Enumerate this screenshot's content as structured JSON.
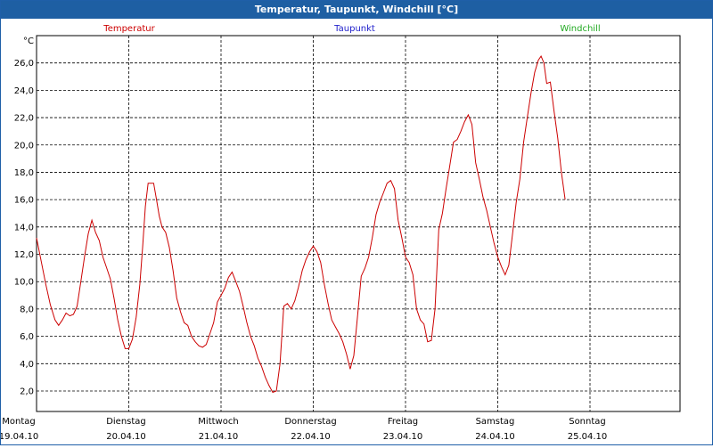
{
  "window": {
    "title": "Temperatur, Taupunkt, Windchill [°C]"
  },
  "chart_data": {
    "type": "line",
    "title": "Temperatur, Taupunkt, Windchill [°C]",
    "ylabel": "°C",
    "ylim": [
      0.5,
      28.0
    ],
    "yticks": [
      "2,0",
      "4,0",
      "6,0",
      "8,0",
      "10,0",
      "12,0",
      "14,0",
      "16,0",
      "18,0",
      "20,0",
      "22,0",
      "24,0",
      "26,0"
    ],
    "ytick_values": [
      2,
      4,
      6,
      8,
      10,
      12,
      14,
      16,
      18,
      20,
      22,
      24,
      26
    ],
    "xlim": [
      0,
      7
    ],
    "xticks": [
      {
        "day": "Montag",
        "date": "19.04.10"
      },
      {
        "day": "Dienstag",
        "date": "20.04.10"
      },
      {
        "day": "Mittwoch",
        "date": "21.04.10"
      },
      {
        "day": "Donnerstag",
        "date": "22.04.10"
      },
      {
        "day": "Freitag",
        "date": "23.04.10"
      },
      {
        "day": "Samstag",
        "date": "24.04.10"
      },
      {
        "day": "Sonntag",
        "date": "25.04.10"
      }
    ],
    "grid": true,
    "legend_position": "top",
    "series": [
      {
        "name": "Temperatur",
        "color": "#cc0000",
        "points": [
          [
            0.0,
            13.2
          ],
          [
            0.05,
            11.5
          ],
          [
            0.1,
            9.8
          ],
          [
            0.15,
            8.3
          ],
          [
            0.2,
            7.2
          ],
          [
            0.24,
            6.8
          ],
          [
            0.28,
            7.2
          ],
          [
            0.32,
            7.7
          ],
          [
            0.36,
            7.5
          ],
          [
            0.4,
            7.6
          ],
          [
            0.44,
            8.2
          ],
          [
            0.48,
            10.0
          ],
          [
            0.52,
            11.8
          ],
          [
            0.56,
            13.5
          ],
          [
            0.6,
            14.5
          ],
          [
            0.64,
            13.6
          ],
          [
            0.68,
            13.0
          ],
          [
            0.72,
            11.8
          ],
          [
            0.76,
            11.0
          ],
          [
            0.8,
            10.2
          ],
          [
            0.84,
            8.8
          ],
          [
            0.88,
            7.2
          ],
          [
            0.92,
            6.0
          ],
          [
            0.96,
            5.1
          ],
          [
            1.0,
            5.1
          ],
          [
            1.04,
            5.8
          ],
          [
            1.08,
            7.4
          ],
          [
            1.12,
            9.8
          ],
          [
            1.15,
            12.5
          ],
          [
            1.18,
            15.5
          ],
          [
            1.21,
            17.2
          ],
          [
            1.27,
            17.2
          ],
          [
            1.3,
            16.0
          ],
          [
            1.33,
            14.8
          ],
          [
            1.36,
            14.0
          ],
          [
            1.4,
            13.6
          ],
          [
            1.44,
            12.5
          ],
          [
            1.48,
            10.8
          ],
          [
            1.52,
            8.8
          ],
          [
            1.56,
            7.8
          ],
          [
            1.6,
            7.0
          ],
          [
            1.64,
            6.8
          ],
          [
            1.68,
            6.0
          ],
          [
            1.72,
            5.6
          ],
          [
            1.76,
            5.3
          ],
          [
            1.8,
            5.2
          ],
          [
            1.84,
            5.4
          ],
          [
            1.88,
            6.2
          ],
          [
            1.92,
            7.0
          ],
          [
            1.96,
            8.5
          ],
          [
            2.0,
            9.0
          ],
          [
            2.04,
            9.5
          ],
          [
            2.08,
            10.3
          ],
          [
            2.12,
            10.7
          ],
          [
            2.16,
            10.0
          ],
          [
            2.2,
            9.3
          ],
          [
            2.24,
            8.2
          ],
          [
            2.28,
            7.0
          ],
          [
            2.32,
            6.0
          ],
          [
            2.36,
            5.3
          ],
          [
            2.4,
            4.4
          ],
          [
            2.44,
            3.8
          ],
          [
            2.48,
            3.0
          ],
          [
            2.52,
            2.4
          ],
          [
            2.56,
            1.9
          ],
          [
            2.6,
            2.0
          ],
          [
            2.64,
            4.0
          ],
          [
            2.68,
            8.2
          ],
          [
            2.72,
            8.4
          ],
          [
            2.76,
            8.0
          ],
          [
            2.8,
            8.6
          ],
          [
            2.84,
            9.6
          ],
          [
            2.88,
            10.8
          ],
          [
            2.92,
            11.6
          ],
          [
            2.96,
            12.2
          ],
          [
            3.0,
            12.6
          ],
          [
            3.04,
            12.2
          ],
          [
            3.08,
            11.4
          ],
          [
            3.12,
            9.8
          ],
          [
            3.16,
            8.4
          ],
          [
            3.2,
            7.2
          ],
          [
            3.24,
            6.7
          ],
          [
            3.28,
            6.2
          ],
          [
            3.32,
            5.6
          ],
          [
            3.36,
            4.7
          ],
          [
            3.4,
            3.6
          ],
          [
            3.44,
            4.6
          ],
          [
            3.48,
            7.5
          ],
          [
            3.52,
            10.4
          ],
          [
            3.56,
            11.0
          ],
          [
            3.6,
            11.8
          ],
          [
            3.64,
            13.2
          ],
          [
            3.68,
            14.9
          ],
          [
            3.72,
            15.8
          ],
          [
            3.76,
            16.5
          ],
          [
            3.8,
            17.2
          ],
          [
            3.84,
            17.4
          ],
          [
            3.88,
            16.8
          ],
          [
            3.92,
            14.5
          ],
          [
            3.96,
            13.2
          ],
          [
            4.0,
            11.8
          ],
          [
            4.04,
            11.4
          ],
          [
            4.08,
            10.5
          ],
          [
            4.12,
            8.0
          ],
          [
            4.16,
            7.2
          ],
          [
            4.2,
            6.9
          ],
          [
            4.24,
            5.6
          ],
          [
            4.28,
            5.7
          ],
          [
            4.32,
            8.0
          ],
          [
            4.36,
            13.8
          ],
          [
            4.4,
            15.0
          ],
          [
            4.44,
            16.8
          ],
          [
            4.48,
            18.5
          ],
          [
            4.52,
            20.2
          ],
          [
            4.56,
            20.4
          ],
          [
            4.6,
            21.0
          ],
          [
            4.64,
            21.7
          ],
          [
            4.68,
            22.2
          ],
          [
            4.72,
            21.5
          ],
          [
            4.76,
            18.7
          ],
          [
            4.8,
            17.5
          ],
          [
            4.84,
            16.2
          ],
          [
            4.88,
            15.2
          ],
          [
            4.92,
            14.0
          ],
          [
            4.96,
            12.8
          ],
          [
            5.0,
            11.8
          ],
          [
            5.04,
            11.1
          ],
          [
            5.08,
            10.5
          ],
          [
            5.12,
            11.2
          ],
          [
            5.16,
            13.5
          ],
          [
            5.2,
            15.8
          ],
          [
            5.24,
            17.5
          ],
          [
            5.28,
            20.2
          ],
          [
            5.32,
            22.0
          ],
          [
            5.36,
            23.8
          ],
          [
            5.4,
            25.3
          ],
          [
            5.44,
            26.2
          ],
          [
            5.47,
            26.5
          ],
          [
            5.5,
            26.0
          ],
          [
            5.53,
            24.5
          ],
          [
            5.57,
            24.6
          ],
          [
            5.61,
            22.5
          ],
          [
            5.65,
            20.5
          ],
          [
            5.69,
            18.0
          ],
          [
            5.73,
            16.0
          ]
        ]
      },
      {
        "name": "Taupunkt",
        "color": "#2222cc",
        "points": []
      },
      {
        "name": "Windchill",
        "color": "#22aa22",
        "points": []
      }
    ]
  }
}
